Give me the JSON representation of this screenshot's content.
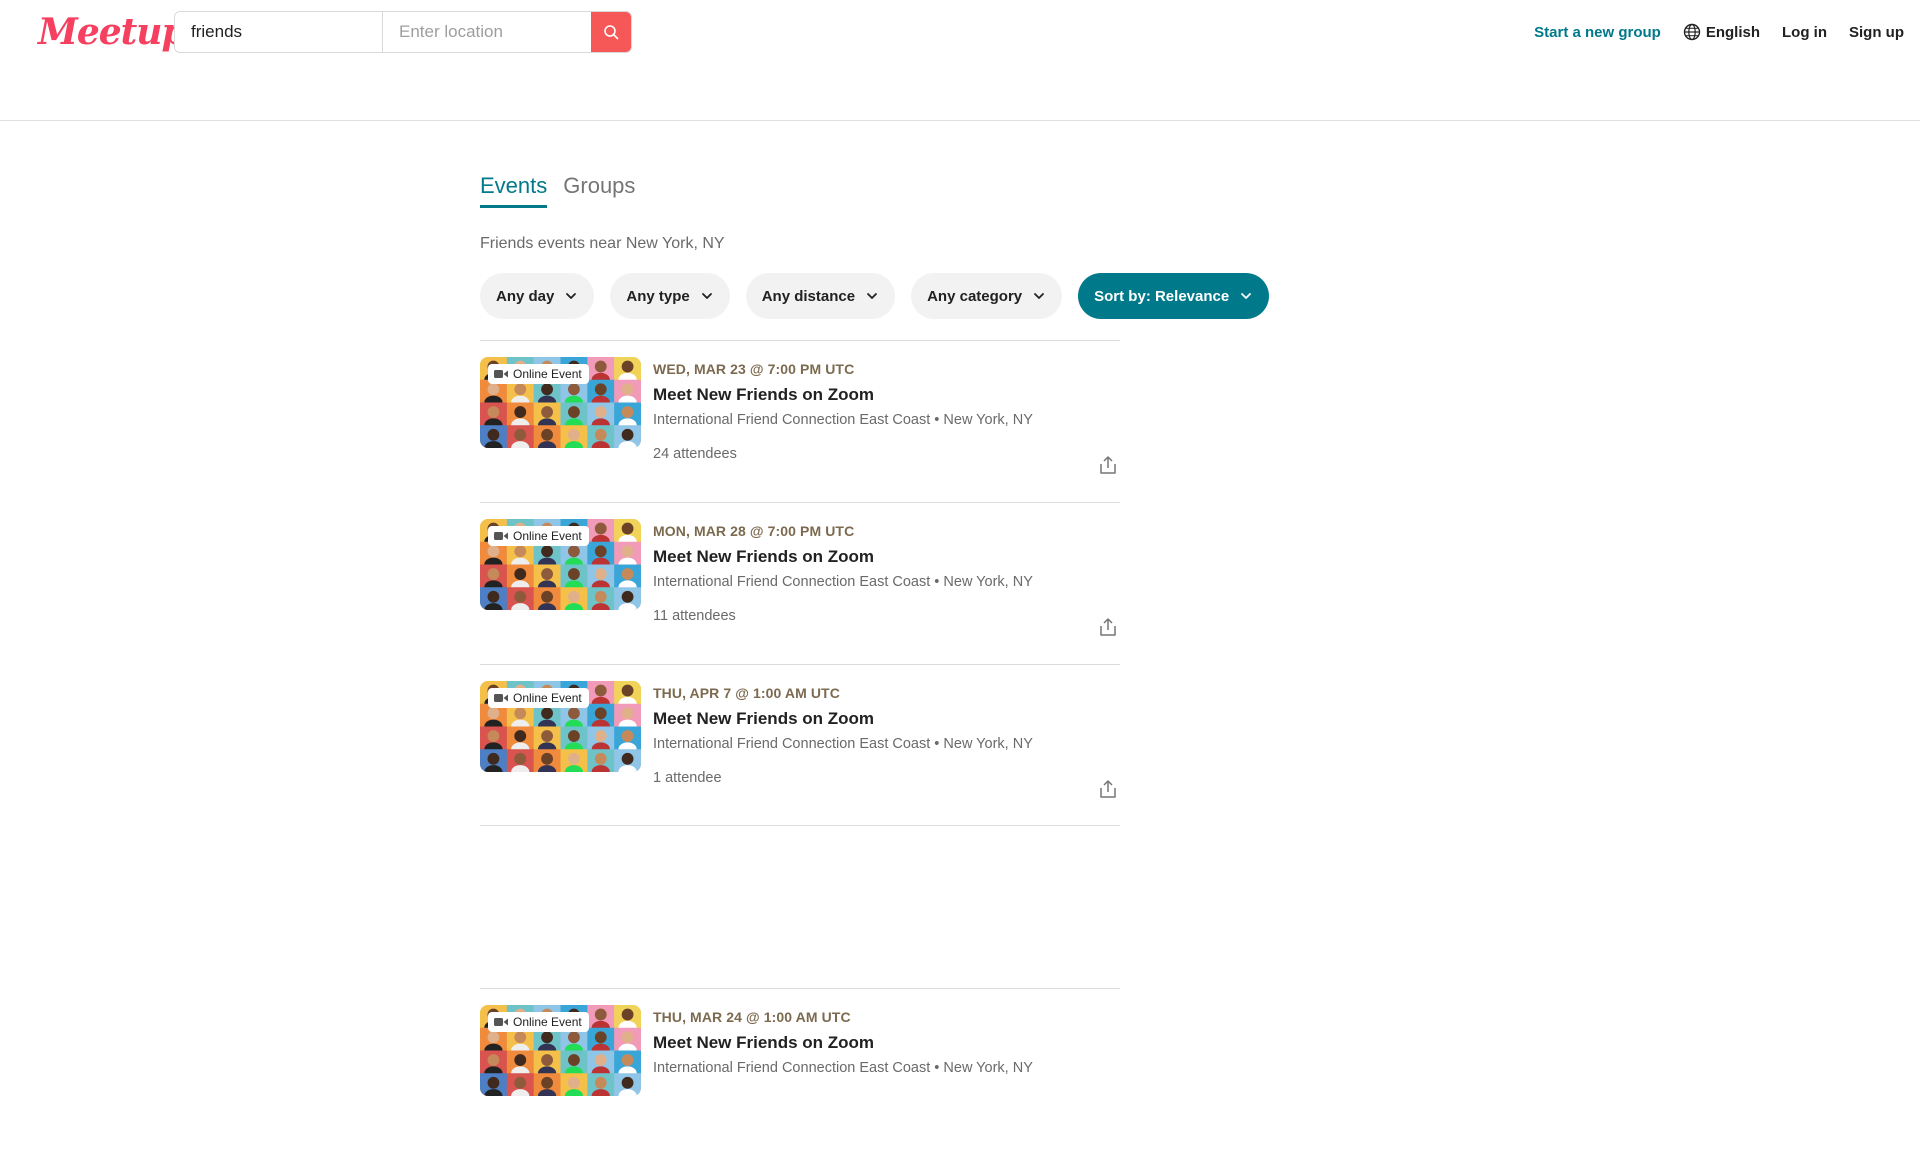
{
  "header": {
    "logo": "Meetup",
    "search_value": "friends",
    "location_placeholder": "Enter location",
    "nav": {
      "start_group": "Start a new group",
      "language": "English",
      "login": "Log in",
      "signup": "Sign up"
    }
  },
  "main": {
    "tabs": [
      {
        "label": "Events",
        "active": true
      },
      {
        "label": "Groups",
        "active": false
      }
    ],
    "subtitle": "Friends events near New York, NY",
    "filters": [
      {
        "label": "Any day"
      },
      {
        "label": "Any type"
      },
      {
        "label": "Any distance"
      },
      {
        "label": "Any category"
      },
      {
        "label": "Sort by: Relevance"
      }
    ],
    "events": [
      {
        "badge": "Online Event",
        "date": "WED, MAR 23 @ 7:00 PM UTC",
        "title": "Meet New Friends on Zoom",
        "group": "International Friend Connection East Coast • New York, NY",
        "attendees": "24 attendees"
      },
      {
        "badge": "Online Event",
        "date": "MON, MAR 28 @ 7:00 PM UTC",
        "title": "Meet New Friends on Zoom",
        "group": "International Friend Connection East Coast • New York, NY",
        "attendees": "11 attendees"
      },
      {
        "badge": "Online Event",
        "date": "THU, APR 7 @ 1:00 AM UTC",
        "title": "Meet New Friends on Zoom",
        "group": "International Friend Connection East Coast • New York, NY",
        "attendees": "1 attendee"
      },
      {
        "badge": "Online Event",
        "date": "THU, MAR 24 @ 1:00 AM UTC",
        "title": "Meet New Friends on Zoom",
        "group": "International Friend Connection East Coast • New York, NY",
        "attendees": ""
      }
    ]
  },
  "colors": {
    "brand": "#f64060",
    "accent": "#00798a",
    "date_text": "#7c6a4f",
    "search_button": "#f65858"
  }
}
